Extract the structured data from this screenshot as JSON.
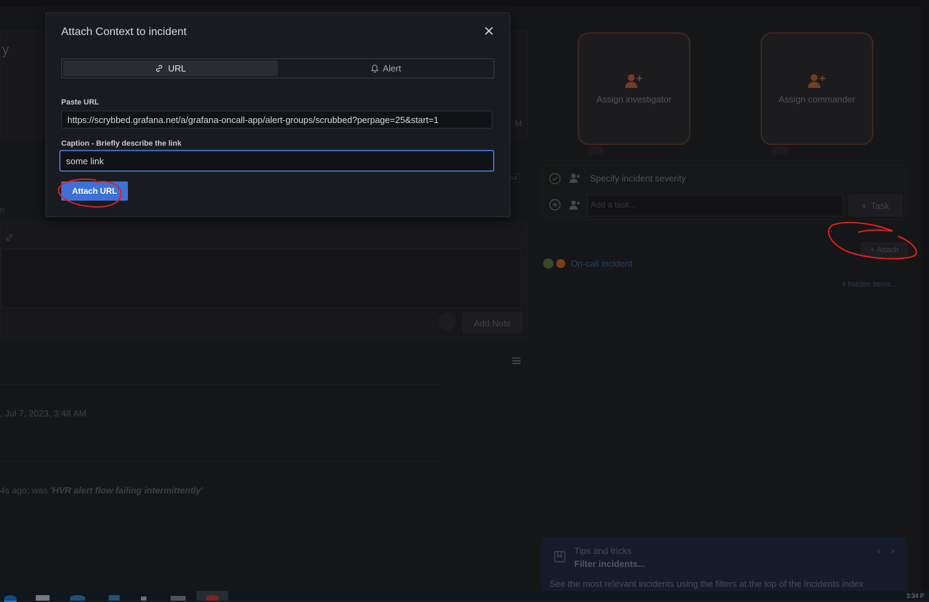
{
  "modal": {
    "title": "Attach Context to incident",
    "tabs": [
      {
        "label": "URL",
        "icon": "link-icon",
        "active": true
      },
      {
        "label": "Alert",
        "icon": "bell-icon",
        "active": false
      }
    ],
    "url_label": "Paste URL",
    "url_value": "https://scrybbed.grafana.net/a/grafana-oncall-app/alert-groups/scrubbed?perpage=25&start=1",
    "caption_label": "Caption - Briefly describe the link",
    "caption_value": "some link",
    "submit_label": "Attach URL"
  },
  "background": {
    "heading_fragment": "y",
    "time_fragment": "M",
    "badge_fragment": "nd",
    "small_fragment": "n",
    "add_note_label": "Add Note",
    "date_text": ", Jul 7, 2023, 3:48 AM",
    "history_prefix": "4s ago; was ",
    "history_quote": "'HVR alert flow failing intermittently'",
    "assign_investigator": "Assign investigator",
    "assign_commander": "Assign commander",
    "task_severity": "Specify incident severity",
    "task_placeholder": "Add a task...",
    "task_button": "Task",
    "attach_button": "Attach",
    "oncall_link": "On-call incident",
    "hidden_items": "4 hidden items...",
    "tips_title": "Tips and tricks",
    "tips_subtitle": "Filter incidents...",
    "tips_body": "See the most relevant incidents using the filters at the top of the Incidents index"
  },
  "taskbar": {
    "clock": "3:34 P"
  },
  "colors": {
    "accent": "#3d71d9",
    "annotation": "#e0201c",
    "assign_border": "#6b3f2f"
  }
}
